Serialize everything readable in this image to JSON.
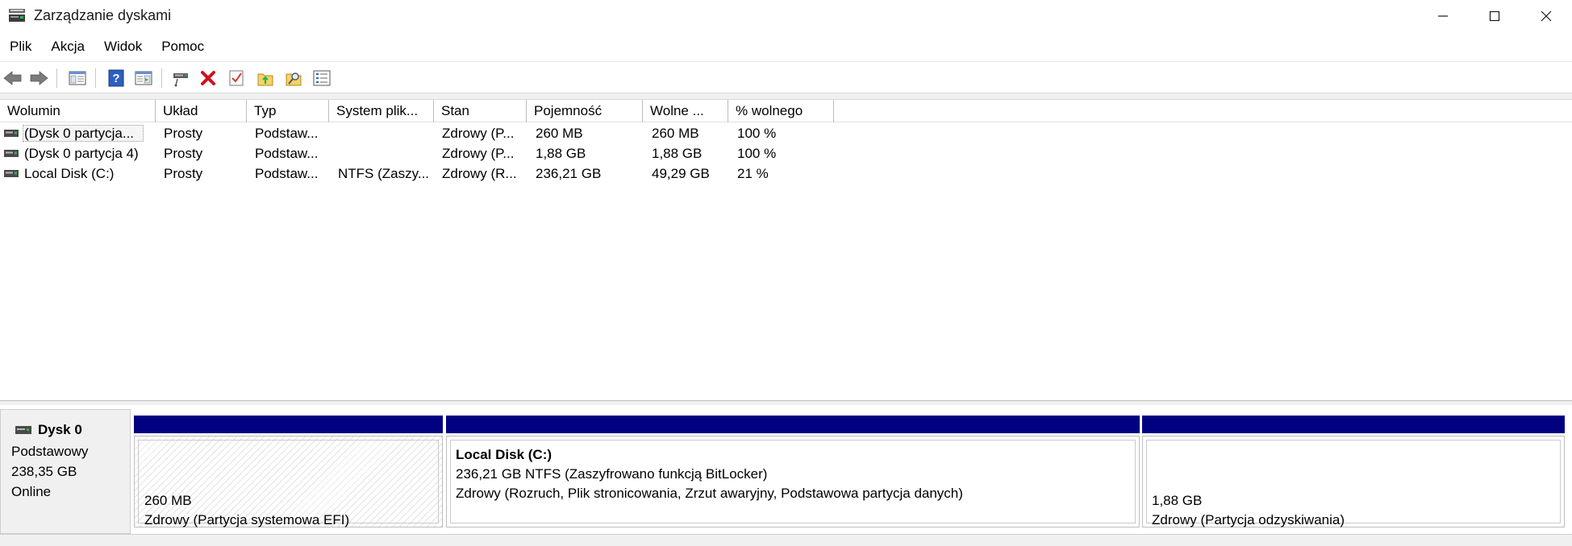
{
  "window": {
    "title": "Zarządzanie dyskami"
  },
  "menu": [
    {
      "label": "Plik"
    },
    {
      "label": "Akcja"
    },
    {
      "label": "Widok"
    },
    {
      "label": "Pomoc"
    }
  ],
  "toolbar": {
    "icons": [
      "back-arrow-icon",
      "forward-arrow-icon",
      "console-tree-icon",
      "help-icon",
      "show-pane-icon",
      "connect-disk-icon",
      "delete-icon",
      "properties-check-icon",
      "move-up-icon",
      "search-folder-icon",
      "list-view-icon"
    ],
    "delete_color": "#d0101a"
  },
  "table": {
    "columns": [
      {
        "label": "Wolumin"
      },
      {
        "label": "Układ"
      },
      {
        "label": "Typ"
      },
      {
        "label": "System plik..."
      },
      {
        "label": "Stan"
      },
      {
        "label": "Pojemność"
      },
      {
        "label": "Wolne ..."
      },
      {
        "label": "% wolnego"
      }
    ],
    "rows": [
      {
        "volume": "(Dysk 0 partycja...",
        "layout": "Prosty",
        "type": "Podstaw...",
        "fs": "",
        "status": "Zdrowy (P...",
        "capacity": "260 MB",
        "free": "260 MB",
        "pct_free": "100 %"
      },
      {
        "volume": "(Dysk 0 partycja 4)",
        "layout": "Prosty",
        "type": "Podstaw...",
        "fs": "",
        "status": "Zdrowy (P...",
        "capacity": "1,88 GB",
        "free": "1,88 GB",
        "pct_free": "100 %"
      },
      {
        "volume": "Local Disk (C:)",
        "layout": "Prosty",
        "type": "Podstaw...",
        "fs": "NTFS (Zaszy...",
        "status": "Zdrowy (R...",
        "capacity": "236,21 GB",
        "free": "49,29 GB",
        "pct_free": "21 %"
      }
    ]
  },
  "disk": {
    "name": "Dysk 0",
    "type": "Podstawowy",
    "size": "238,35 GB",
    "state": "Online",
    "partitions": [
      {
        "title": "",
        "line1": "260 MB",
        "line2": "Zdrowy (Partycja systemowa EFI)"
      },
      {
        "title": "Local Disk  (C:)",
        "line1": "236,21 GB NTFS (Zaszyfrowano funkcją BitLocker)",
        "line2": "Zdrowy (Rozruch, Plik stronicowania, Zrzut awaryjny, Podstawowa partycja danych)"
      },
      {
        "title": "",
        "line1": "1,88 GB",
        "line2": "Zdrowy (Partycja odzyskiwania)"
      }
    ],
    "partition_bar_color": "#000080"
  }
}
